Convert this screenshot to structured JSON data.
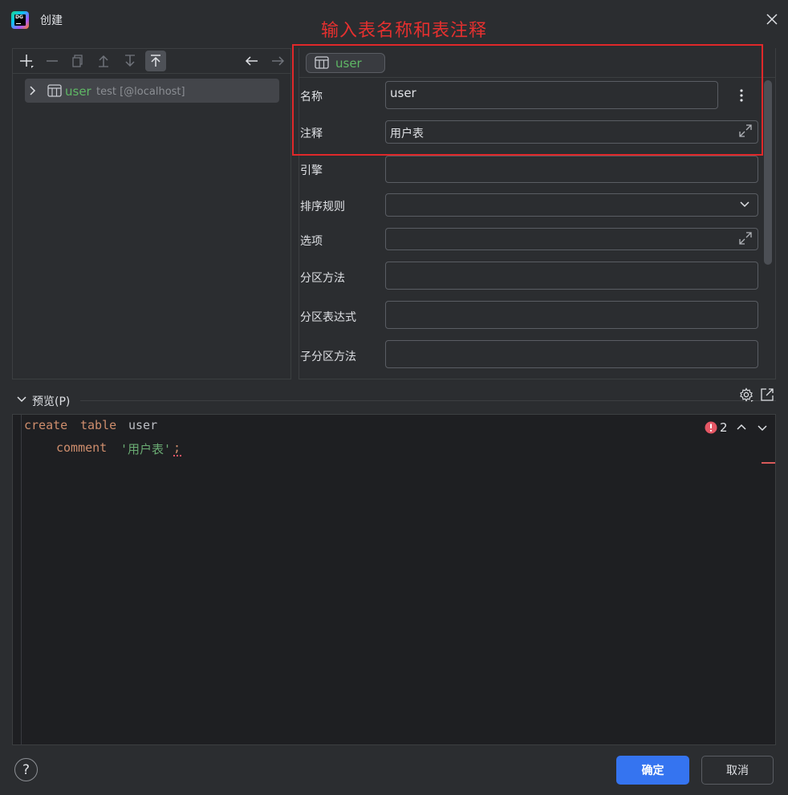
{
  "window": {
    "title": "创建"
  },
  "annotation": {
    "text": "输入表名称和表注释",
    "color": "#e5302f"
  },
  "toolbar": {
    "icons": [
      "add-icon",
      "remove-icon",
      "copy-icon",
      "move-up-icon",
      "move-down-icon",
      "move-top-icon",
      "back-arrow-icon",
      "forward-arrow-icon"
    ]
  },
  "tree": {
    "item": {
      "label": "user",
      "sublabel": "test [@localhost]"
    }
  },
  "tab": {
    "label": "user"
  },
  "form": {
    "name_label": "名称",
    "name_value": "user",
    "comment_label": "注释",
    "comment_value": "用户表",
    "engine_label": "引擎",
    "collation_label": "排序规则",
    "options_label": "选项",
    "partition_method_label": "分区方法",
    "partition_expr_label": "分区表达式",
    "subpartition_method_label": "子分区方法"
  },
  "preview": {
    "label": "预览(P)",
    "code": {
      "line1_kw1": "create",
      "line1_kw2": "table",
      "line1_id": "user",
      "line2_kw": "comment",
      "line2_str": "'用户表'",
      "line2_end": ";"
    },
    "error_count": "2"
  },
  "footer": {
    "help_label": "?",
    "ok_label": "确定",
    "cancel_label": "取消"
  },
  "colors": {
    "accent": "#3574f0",
    "table_name_green": "#5fb865",
    "error_red": "#e55765"
  }
}
